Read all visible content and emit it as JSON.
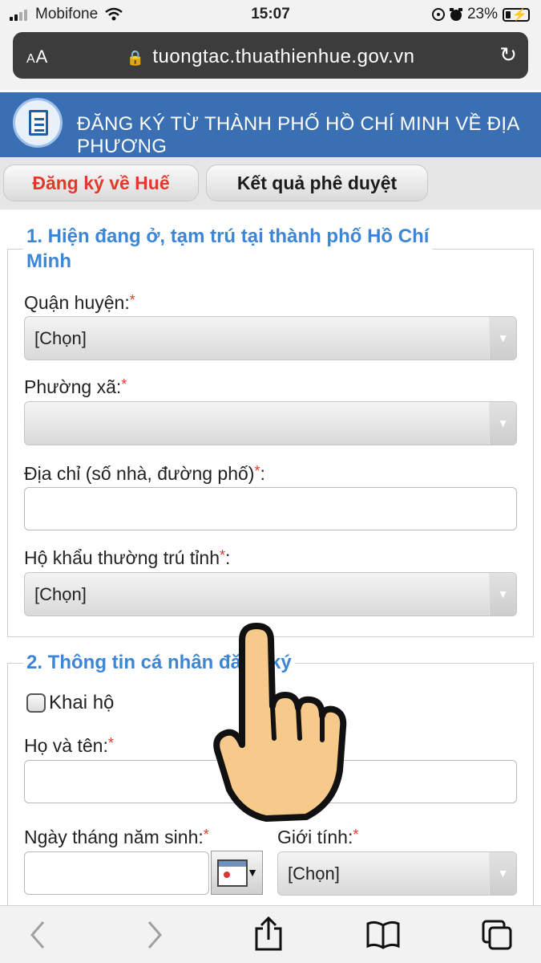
{
  "status_bar": {
    "carrier": "Mobifone",
    "time": "15:07",
    "battery": "23%"
  },
  "browser": {
    "text_size_button": "AA",
    "url": "tuongtac.thuathienhue.gov.vn"
  },
  "banner": {
    "title": "ĐĂNG KÝ TỪ THÀNH PHỐ HỒ CHÍ MINH VỀ ĐỊA PHƯƠNG"
  },
  "tabs": {
    "register": "Đăng ký về Huế",
    "results": "Kết quả phê duyệt"
  },
  "section1": {
    "legend_line1": "1. Hiện đang ở, tạm trú tại thành phố Hồ Chí",
    "legend_line2": "Minh",
    "district_label": "Quận huyện:",
    "district_value": "[Chọn]",
    "ward_label": "Phường xã:",
    "ward_value": "",
    "address_label": "Địa chỉ (số nhà, đường phố)",
    "address_label_suffix": ":",
    "address_value": "",
    "province_label": "Hộ khẩu thường trú tỉnh",
    "province_label_suffix": ":",
    "province_value": "[Chọn]"
  },
  "section2": {
    "legend": "2. Thông tin cá nhân đăng ký",
    "declare_label": "Khai hộ",
    "fullname_label": "Họ và tên:",
    "fullname_value": "",
    "dob_label": "Ngày tháng năm sinh:",
    "dob_value": "",
    "gender_label": "Giới tính:",
    "gender_value": "[Chọn]"
  },
  "required_mark": "*",
  "colors": {
    "banner": "#3b6fb3",
    "legend": "#3d86d6",
    "active_tab": "#e03a2c",
    "required": "#e03a2c"
  },
  "icons": [
    "signal-icon",
    "wifi-icon",
    "lock-icon",
    "reload-icon",
    "alarm-icon",
    "battery-icon",
    "calendar-icon",
    "back-icon",
    "forward-icon",
    "share-icon",
    "bookmarks-icon",
    "tabs-icon",
    "pointing-hand-icon"
  ]
}
